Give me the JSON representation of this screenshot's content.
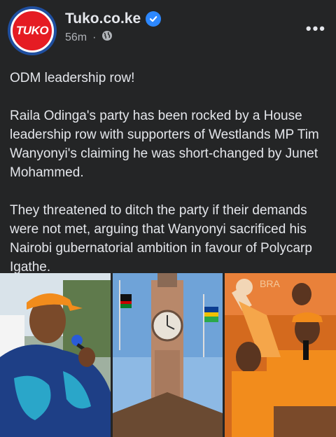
{
  "post": {
    "page_name": "Tuko.co.ke",
    "avatar_text": "TUKO",
    "timestamp": "56m",
    "separator": "·",
    "audience_icon": "globe-icon",
    "verified_icon": "verified-badge-icon",
    "more_icon": "more-options-icon",
    "more_label": "•••",
    "paragraphs": [
      "ODM leadership row!",
      "Raila Odinga's party has been rocked by a House leadership row with supporters of Westlands MP Tim Wanyonyi's claiming he was short-changed by Junet Mohammed.",
      "They threatened to ditch the party if their demands were not met, arguing that Wanyonyi sacrificed his Nairobi gubernatorial ambition in favour of Polycarp Igathe."
    ]
  },
  "colors": {
    "background": "#242526",
    "text": "#e4e6eb",
    "secondary_text": "#b0b3b8",
    "brand_red": "#e51c23",
    "verified_blue": "#2d88ff"
  }
}
